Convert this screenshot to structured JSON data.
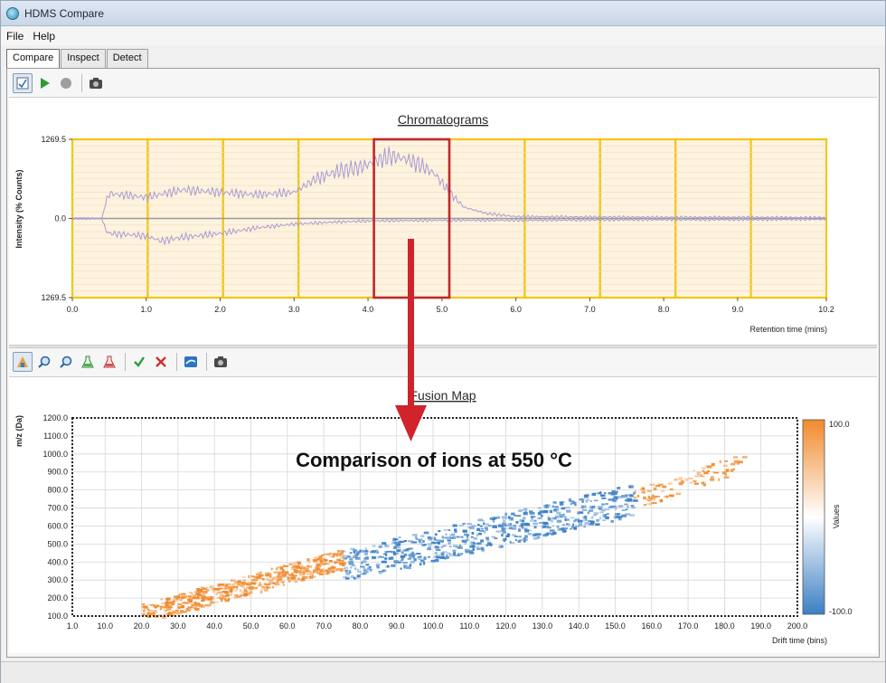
{
  "window": {
    "title": "HDMS Compare"
  },
  "menu": [
    "File",
    "Help"
  ],
  "tabs": [
    {
      "label": "Compare",
      "active": true
    },
    {
      "label": "Inspect",
      "active": false
    },
    {
      "label": "Detect",
      "active": false
    }
  ],
  "top_toolbar": {
    "icons": [
      "select-icon",
      "play-icon",
      "stop-icon",
      "camera-icon"
    ]
  },
  "bottom_toolbar": {
    "icons": [
      "color-map-icon",
      "zoom-in-icon",
      "zoom-out-icon",
      "flask-green-icon",
      "flask-red-icon",
      "check-icon",
      "cross-icon",
      "display-icon",
      "camera-icon"
    ]
  },
  "colors": {
    "trace": "#a99bd3",
    "segment_border": "#f2c511",
    "segment_fill": "#fdf3de",
    "selection": "#c0282f",
    "arrow": "#d0232c",
    "heat_high": "#f08a2c",
    "heat_low": "#3b7fc4"
  },
  "chart_data": [
    {
      "type": "line",
      "title": "Chromatograms",
      "xlabel": "Retention time (mins)",
      "ylabel": "Intensity (% Counts)",
      "xlim": [
        0.0,
        10.2
      ],
      "ylim": [
        -1269.5,
        1269.5
      ],
      "x_ticks": [
        "0.0",
        "1.0",
        "2.0",
        "3.0",
        "4.0",
        "5.0",
        "6.0",
        "7.0",
        "8.0",
        "9.0",
        "10.2"
      ],
      "y_ticks": [
        "1269.5",
        "0.0",
        "1269.5"
      ],
      "segments": [
        [
          0.0,
          1.02
        ],
        [
          1.02,
          2.04
        ],
        [
          2.04,
          3.06
        ],
        [
          3.06,
          4.08
        ],
        [
          4.08,
          5.1
        ],
        [
          5.1,
          6.12
        ],
        [
          6.12,
          7.14
        ],
        [
          7.14,
          8.16
        ],
        [
          8.16,
          9.18
        ],
        [
          9.18,
          10.2
        ]
      ],
      "selected_segment": [
        4.08,
        5.1
      ],
      "series": [
        {
          "x": [
            0.0,
            0.4,
            0.45,
            0.5,
            1.0,
            1.5,
            2.0,
            2.5,
            3.0,
            3.3,
            3.6,
            3.9,
            4.1,
            4.3,
            4.5,
            4.7,
            4.9,
            5.1,
            5.3,
            5.6,
            6.0,
            7.0,
            8.0,
            9.0,
            10.2
          ],
          "y": [
            0,
            0,
            250,
            400,
            340,
            460,
            420,
            380,
            420,
            640,
            760,
            820,
            920,
            1000,
            960,
            860,
            720,
            420,
            180,
            80,
            30,
            25,
            20,
            20,
            15
          ]
        },
        {
          "x": [
            0.0,
            0.4,
            0.45,
            0.5,
            1.0,
            1.2,
            1.5,
            2.0,
            2.5,
            3.0,
            3.5,
            4.0,
            5.0,
            6.0,
            7.0,
            8.0,
            9.0,
            10.2
          ],
          "y": [
            0,
            0,
            -180,
            -240,
            -280,
            -360,
            -300,
            -240,
            -150,
            -90,
            -60,
            -40,
            -30,
            -30,
            -25,
            -20,
            -20,
            -15
          ]
        }
      ]
    },
    {
      "type": "heatmap",
      "title": "Fusion Map",
      "xlabel": "Drift time (bins)",
      "ylabel": "m/z (Da)",
      "xlim": [
        1.0,
        200.0
      ],
      "ylim": [
        100.0,
        1200.0
      ],
      "x_ticks": [
        "1.0",
        "10.0",
        "20.0",
        "30.0",
        "40.0",
        "50.0",
        "60.0",
        "70.0",
        "80.0",
        "90.0",
        "100.0",
        "110.0",
        "120.0",
        "130.0",
        "140.0",
        "150.0",
        "160.0",
        "170.0",
        "180.0",
        "190.0",
        "200.0"
      ],
      "y_ticks": [
        "100.0",
        "200.0",
        "300.0",
        "400.0",
        "500.0",
        "600.0",
        "700.0",
        "800.0",
        "900.0",
        "1000.0",
        "1100.0",
        "1200.0"
      ],
      "colorbar": {
        "label": "Values",
        "max": "100.0",
        "min": "-100.0"
      },
      "clusters": [
        {
          "drift_range": [
            20,
            75
          ],
          "mz_start": 120,
          "mz_end": 420,
          "value": 100
        },
        {
          "drift_range": [
            75,
            155
          ],
          "mz_start": 380,
          "mz_end": 750,
          "value": -100
        },
        {
          "drift_range": [
            155,
            185
          ],
          "mz_start": 750,
          "mz_end": 960,
          "value": 60
        }
      ]
    }
  ],
  "annotation": {
    "text": "Comparison of ions at 550 °C"
  }
}
